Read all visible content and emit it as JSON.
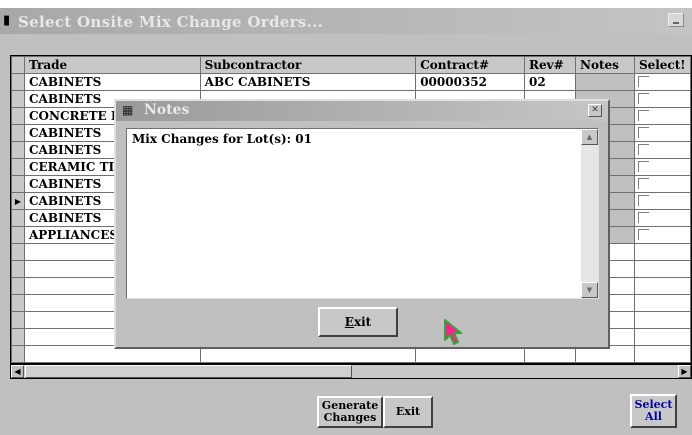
{
  "window": {
    "title": "Select Onsite Mix Change Orders..."
  },
  "grid": {
    "columns": [
      "Trade",
      "Subcontractor",
      "Contract#",
      "Rev#",
      "Notes",
      "Select!"
    ],
    "rows": [
      {
        "trade": "CABINETS",
        "sub": "ABC CABINETS",
        "contract": "00000352",
        "rev": "02"
      },
      {
        "trade": "CABINETS",
        "sub": "",
        "contract": "",
        "rev": ""
      },
      {
        "trade": "CONCRETE F",
        "sub": "",
        "contract": "",
        "rev": ""
      },
      {
        "trade": "CABINETS",
        "sub": "",
        "contract": "",
        "rev": ""
      },
      {
        "trade": "CABINETS",
        "sub": "",
        "contract": "",
        "rev": ""
      },
      {
        "trade": "CERAMIC TIL",
        "sub": "",
        "contract": "",
        "rev": ""
      },
      {
        "trade": "CABINETS",
        "sub": "",
        "contract": "",
        "rev": ""
      },
      {
        "trade": "CABINETS",
        "sub": "",
        "contract": "",
        "rev": "",
        "current": true
      },
      {
        "trade": "CABINETS",
        "sub": "",
        "contract": "",
        "rev": ""
      },
      {
        "trade": "APPLIANCES",
        "sub": "",
        "contract": "",
        "rev": ""
      }
    ],
    "empty_rows": 7
  },
  "buttons": {
    "generate_changes": "Generate Changes",
    "exit": "Exit",
    "select_all": "Select All"
  },
  "dialog": {
    "title": "Notes",
    "memo_text": "Mix Changes for Lot(s): 01",
    "exit_label_first": "E",
    "exit_label_rest": "xit"
  },
  "colors": {
    "window_bg": "#c0c0c0",
    "title_text": "#e8e8e8",
    "cursor_pink": "#ff1f8f",
    "cursor_green": "#2ea82e"
  }
}
